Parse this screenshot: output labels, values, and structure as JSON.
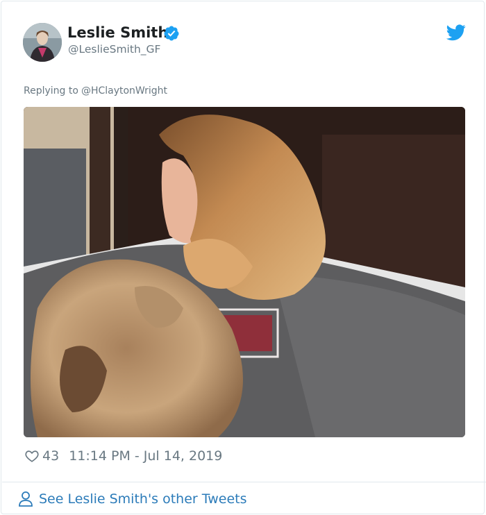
{
  "tweet": {
    "author_name": "Leslie Smith",
    "author_handle": "@LeslieSmith_GF",
    "reply_prefix": "Replying to",
    "reply_to": "@HClaytonWright",
    "likes": "43",
    "timestamp": "11:14 PM - Jul 14, 2019",
    "more_tweets_label": "See Leslie Smith's other Tweets",
    "photo": "photo of a woman with long wavy hair reclining with a fluffy dog",
    "icons": {
      "verified": "verified-badge-icon",
      "brand": "twitter-bird-icon",
      "like": "heart-icon",
      "profile": "person-icon"
    }
  },
  "colors": {
    "brand_blue": "#1da1f2",
    "link_blue": "#2b7bb9",
    "muted_text": "#697882",
    "primary_text": "#1c2022",
    "border": "#e1e8ed"
  }
}
